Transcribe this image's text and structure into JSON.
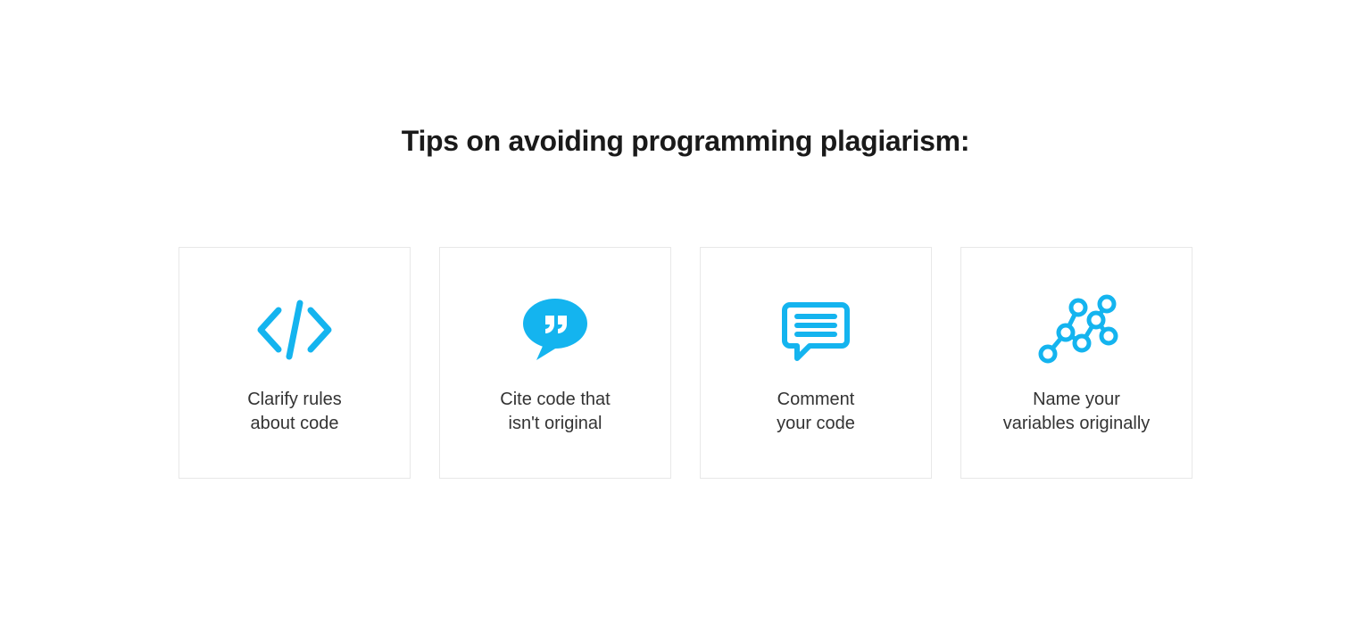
{
  "title": "Tips on avoiding programming plagiarism:",
  "accent": "#14b4ef",
  "cards": [
    {
      "icon": "code",
      "text": "Clarify rules\nabout code"
    },
    {
      "icon": "quote-bubble",
      "text": "Cite code that\nisn't original"
    },
    {
      "icon": "comment-lines",
      "text": "Comment\nyour code"
    },
    {
      "icon": "network",
      "text": "Name your\nvariables originally"
    }
  ]
}
